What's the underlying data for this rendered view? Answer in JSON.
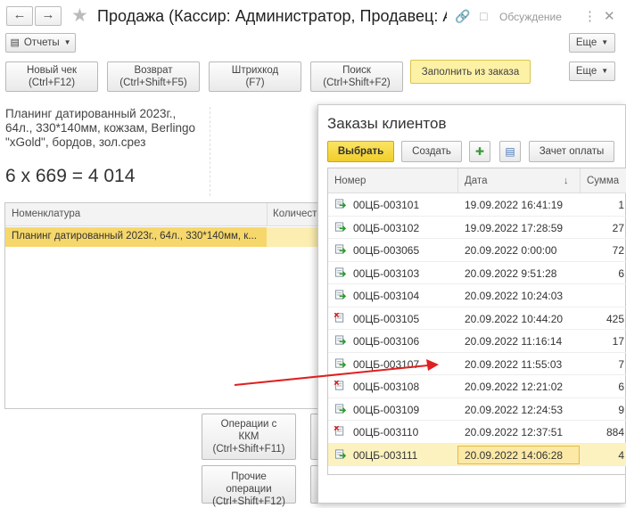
{
  "header": {
    "title": "Продажа (Кассир: Администратор, Продавец: А...",
    "discussion": "Обсуждение"
  },
  "toolbar": {
    "reports": "Отчеты",
    "more": "Еще",
    "more2": "Еще"
  },
  "actions": {
    "new_check": "Новый чек",
    "new_check_key": "(Ctrl+F12)",
    "return": "Возврат",
    "return_key": "(Ctrl+Shift+F5)",
    "barcode": "Штрихкод",
    "barcode_key": "(F7)",
    "search": "Поиск",
    "search_key": "(Ctrl+Shift+F2)",
    "fill_from_order": "Заполнить из заказа"
  },
  "product": {
    "name": "Планинг датированный 2023г., 64л., 330*140мм, кожзам, Berlingo \"xGold\", бордов, зол.срез",
    "calc": "6 x 669 = 4 014"
  },
  "items_table": {
    "col_item": "Номенклатура",
    "col_qty": "Количест",
    "row_item": "Планинг датированный 2023г., 64л., 330*140мм, к..."
  },
  "bottom_buttons": {
    "kkm_ops": "Операции с",
    "kkm_ops2": "ККМ",
    "kkm_key": "(Ctrl+Shift+F11)",
    "other_ops": "Прочие",
    "other_ops2": "операции",
    "other_key": "(Ctrl+Shift+F12)"
  },
  "popup": {
    "title": "Заказы клиентов",
    "select": "Выбрать",
    "create": "Создать",
    "payment": "Зачет оплаты",
    "col_number": "Номер",
    "col_date": "Дата",
    "col_sum": "Сумма",
    "sort_icon": "arrow-down",
    "rows": [
      {
        "number": "00ЦБ-003101",
        "date": "19.09.2022 16:41:19",
        "sum": "1",
        "status": "ok"
      },
      {
        "number": "00ЦБ-003102",
        "date": "19.09.2022 17:28:59",
        "sum": "27",
        "status": "ok"
      },
      {
        "number": "00ЦБ-003065",
        "date": "20.09.2022 0:00:00",
        "sum": "72",
        "status": "ok"
      },
      {
        "number": "00ЦБ-003103",
        "date": "20.09.2022 9:51:28",
        "sum": "6",
        "status": "ok"
      },
      {
        "number": "00ЦБ-003104",
        "date": "20.09.2022 10:24:03",
        "sum": "",
        "status": "ok"
      },
      {
        "number": "00ЦБ-003105",
        "date": "20.09.2022 10:44:20",
        "sum": "425",
        "status": "deleted"
      },
      {
        "number": "00ЦБ-003106",
        "date": "20.09.2022 11:16:14",
        "sum": "17",
        "status": "ok"
      },
      {
        "number": "00ЦБ-003107",
        "date": "20.09.2022 11:55:03",
        "sum": "7",
        "status": "ok"
      },
      {
        "number": "00ЦБ-003108",
        "date": "20.09.2022 12:21:02",
        "sum": "6",
        "status": "deleted"
      },
      {
        "number": "00ЦБ-003109",
        "date": "20.09.2022 12:24:53",
        "sum": "9",
        "status": "ok"
      },
      {
        "number": "00ЦБ-003110",
        "date": "20.09.2022 12:37:51",
        "sum": "884",
        "status": "deleted"
      },
      {
        "number": "00ЦБ-003111",
        "date": "20.09.2022 14:06:28",
        "sum": "4",
        "status": "ok",
        "selected": true
      }
    ]
  },
  "colors": {
    "accent_yellow": "#f5d93e",
    "selection": "#fcf2c0",
    "arrow": "#e02020"
  }
}
